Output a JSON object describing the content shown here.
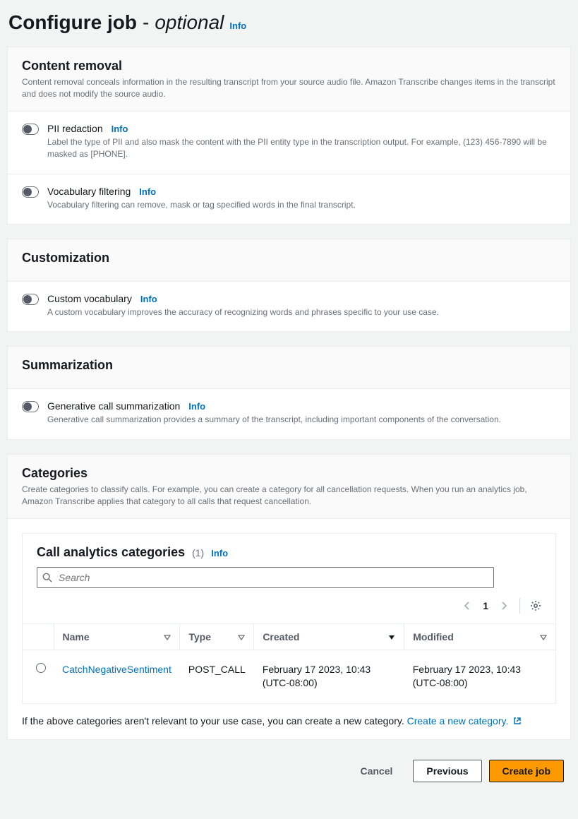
{
  "pageTitle": {
    "main": "Configure job",
    "dash": "-",
    "optional": "optional",
    "info": "Info"
  },
  "panels": {
    "contentRemoval": {
      "title": "Content removal",
      "desc": "Content removal conceals information in the resulting transcript from your source audio file. Amazon Transcribe changes items in the transcript and does not modify the source audio.",
      "pii": {
        "label": "PII redaction",
        "info": "Info",
        "desc": "Label the type of PII and also mask the content with the PII entity type in the transcription output. For example, (123) 456-7890 will be masked as [PHONE]."
      },
      "vocabFilter": {
        "label": "Vocabulary filtering",
        "info": "Info",
        "desc": "Vocabulary filtering can remove, mask or tag specified words in the final transcript."
      }
    },
    "customization": {
      "title": "Customization",
      "customVocab": {
        "label": "Custom vocabulary",
        "info": "Info",
        "desc": "A custom vocabulary improves the accuracy of recognizing words and phrases specific to your use case."
      }
    },
    "summarization": {
      "title": "Summarization",
      "gen": {
        "label": "Generative call summarization",
        "info": "Info",
        "desc": "Generative call summarization provides a summary of the transcript, including important components of the conversation."
      }
    },
    "categories": {
      "title": "Categories",
      "desc": "Create categories to classify calls. For example, you can create a category for all cancellation requests. When you run an analytics job, Amazon Transcribe applies that category to all calls that request cancellation.",
      "inner": {
        "title": "Call analytics categories",
        "count": "(1)",
        "info": "Info",
        "searchPlaceholder": "Search",
        "page": "1",
        "columns": {
          "name": "Name",
          "type": "Type",
          "created": "Created",
          "modified": "Modified"
        },
        "row": {
          "name": "CatchNegativeSentiment",
          "type": "POST_CALL",
          "created": "February 17 2023, 10:43 (UTC-08:00)",
          "modified": "February 17 2023, 10:43 (UTC-08:00)"
        }
      },
      "noteText": "If the above categories aren't relevant to your use case, you can create a new category. ",
      "noteLink": "Create a new category."
    }
  },
  "footer": {
    "cancel": "Cancel",
    "previous": "Previous",
    "create": "Create job"
  }
}
